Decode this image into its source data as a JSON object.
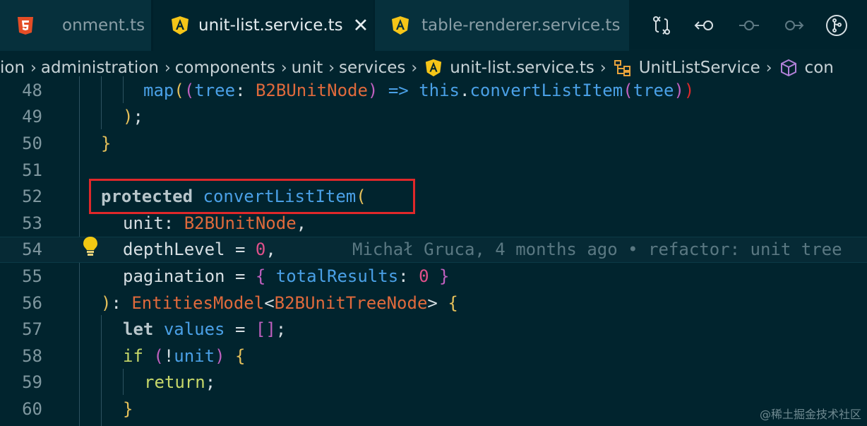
{
  "tabs": [
    {
      "label": "onment.ts",
      "icon": "html5-icon",
      "active": false
    },
    {
      "label": "unit-list.service.ts",
      "icon": "angular-icon",
      "active": true
    },
    {
      "label": "table-renderer.service.ts",
      "icon": "angular-icon",
      "active": false
    }
  ],
  "toolbar": {
    "icons": [
      "compare-changes-icon",
      "go-back-icon",
      "commit-icon",
      "go-forward-icon",
      "git-graph-icon"
    ]
  },
  "breadcrumb": {
    "items": [
      "ion",
      "administration",
      "components",
      "unit",
      "services",
      "unit-list.service.ts",
      "UnitListService",
      "con"
    ]
  },
  "editor": {
    "lines": [
      {
        "n": "48"
      },
      {
        "n": "49"
      },
      {
        "n": "50"
      },
      {
        "n": "51"
      },
      {
        "n": "52"
      },
      {
        "n": "53"
      },
      {
        "n": "54"
      },
      {
        "n": "55"
      },
      {
        "n": "56"
      },
      {
        "n": "57"
      },
      {
        "n": "58"
      },
      {
        "n": "59"
      },
      {
        "n": "60"
      }
    ],
    "tokens": {
      "map": "map",
      "tree": "tree",
      "b2bUnitNode": "B2BUnitNode",
      "arrow": "=>",
      "this": "this",
      "convertListItem": "convertListItem",
      "protected": "protected",
      "unit": "unit",
      "depthLevel": "depthLevel",
      "zero": "0",
      "pagination": "pagination",
      "totalResults": "totalResults",
      "entitiesModel": "EntitiesModel",
      "b2bUnitTreeNode": "B2BUnitTreeNode",
      "let": "let",
      "values": "values",
      "if": "if",
      "return": "return"
    },
    "blame": "Michał Gruca, 4 months ago • refactor: unit tree"
  },
  "watermark": "@稀土掘金技术社区",
  "colors": {
    "background": "#01242e",
    "highlight_border": "#e0282a",
    "function": "#4aa0e6",
    "type": "#e06a3c",
    "number": "#e0508a"
  }
}
